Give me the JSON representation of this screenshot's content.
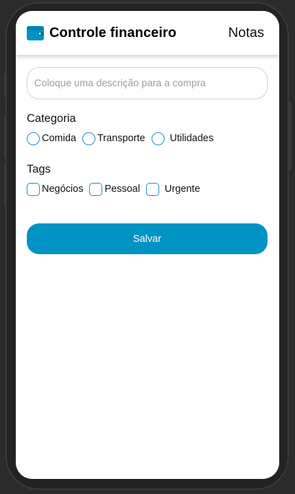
{
  "header": {
    "icon": "wallet-icon",
    "title": "Controle financeiro",
    "nav_link": "Notas"
  },
  "form": {
    "description_placeholder": "Coloque uma descrição para a compra",
    "description_value": "",
    "category": {
      "label": "Categoria",
      "options": [
        {
          "label": "Comida",
          "selected": false
        },
        {
          "label": "Transporte",
          "selected": false
        },
        {
          "label": "Utilidades",
          "selected": false
        }
      ]
    },
    "tags": {
      "label": "Tags",
      "options": [
        {
          "label": "Negócios",
          "checked": false
        },
        {
          "label": "Pessoal",
          "checked": false
        },
        {
          "label": "Urgente",
          "checked": false
        }
      ]
    },
    "save_label": "Salvar"
  },
  "colors": {
    "accent": "#0193c4",
    "control_border": "#1591c2",
    "app_background": "#ffffff",
    "device_frame": "#232323"
  }
}
